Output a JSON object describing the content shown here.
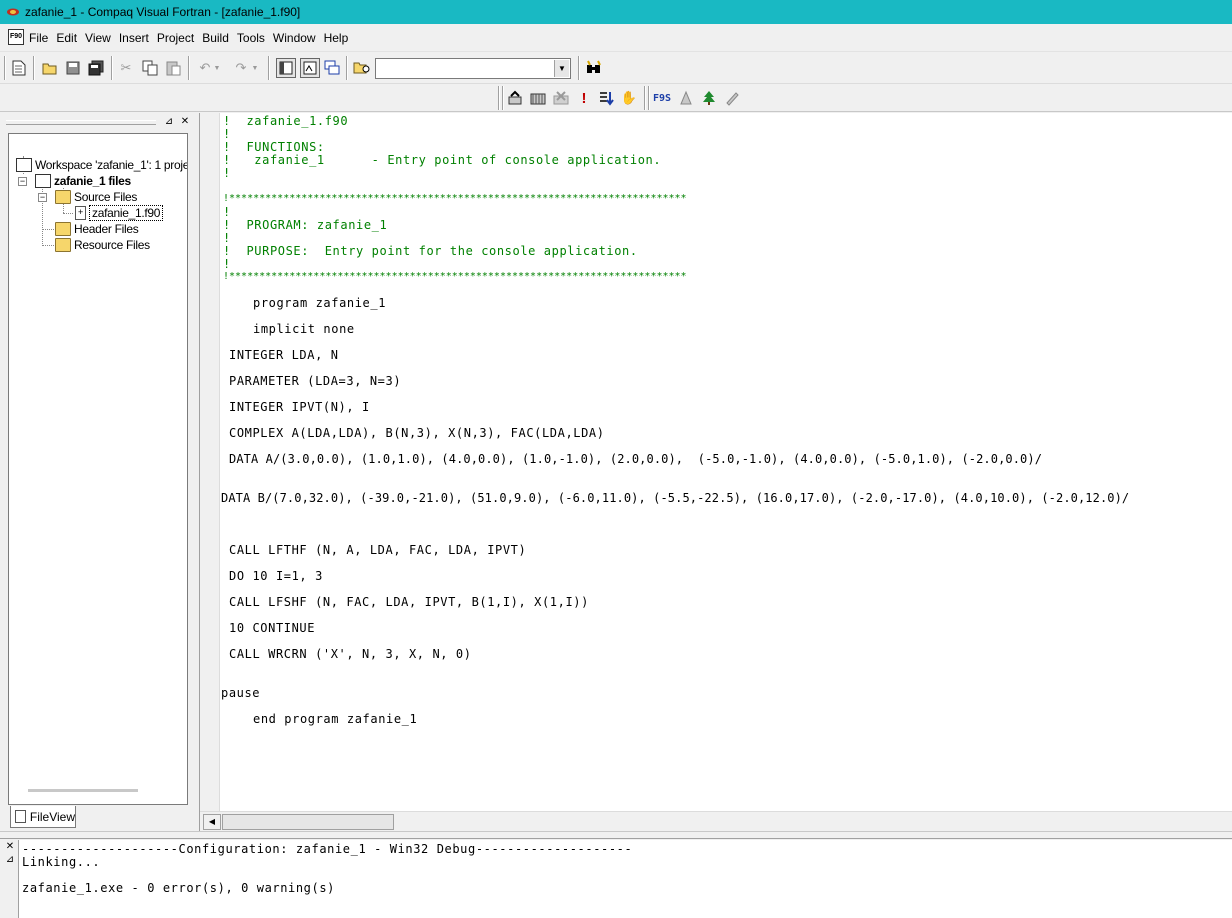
{
  "window": {
    "title": "zafanie_1 - Compaq Visual Fortran - [zafanie_1.f90]",
    "app_icon": "compaq-fortran-icon"
  },
  "menubar": {
    "doc_icon_text": "F90",
    "items": [
      "File",
      "Edit",
      "View",
      "Insert",
      "Project",
      "Build",
      "Tools",
      "Window",
      "Help"
    ]
  },
  "toolbar": {
    "combo_value": "",
    "fortran_label": "F9S"
  },
  "workspace": {
    "root": "Workspace 'zafanie_1': 1 proje",
    "project": "zafanie_1 files",
    "folders": [
      "Source Files",
      "Header Files",
      "Resource Files"
    ],
    "source_file": "zafanie_1.f90",
    "tab_label": "FileView"
  },
  "editor": {
    "lines": [
      "!  zafanie_1.f90",
      "!",
      "!  FUNCTIONS:",
      "!   zafanie_1      - Entry point of console application.",
      "!",
      "!****************************************************************************",
      "!",
      "!  PROGRAM: zafanie_1",
      "!",
      "!  PURPOSE:  Entry point for the console application.",
      "!",
      "!****************************************************************************",
      "program zafanie_1",
      "implicit none",
      "INTEGER LDA, N",
      "PARAMETER (LDA=3, N=3)",
      "INTEGER IPVT(N), I",
      "COMPLEX A(LDA,LDA), B(N,3), X(N,3), FAC(LDA,LDA)",
      "DATA A/(3.0,0.0), (1.0,1.0), (4.0,0.0), (1.0,-1.0), (2.0,0.0),  (-5.0,-1.0), (4.0,0.0), (-5.0,1.0), (-2.0,0.0)/",
      "DATA B/(7.0,32.0), (-39.0,-21.0), (51.0,9.0), (-6.0,11.0), (-5.5,-22.5), (16.0,17.0), (-2.0,-17.0), (4.0,10.0), (-2.0,12.0)/",
      "CALL LFTHF (N, A, LDA, FAC, LDA, IPVT)",
      "DO 10 I=1, 3",
      "CALL LFSHF (N, FAC, LDA, IPVT, B(1,I), X(1,I))",
      "10 CONTINUE",
      "CALL WRCRN ('X', N, 3, X, N, 0)",
      "pause",
      "end program zafanie_1"
    ]
  },
  "output": {
    "lines": [
      "--------------------Configuration: zafanie_1 - Win32 Debug--------------------",
      "Linking...",
      "zafanie_1.exe - 0 error(s), 0 warning(s)"
    ]
  }
}
